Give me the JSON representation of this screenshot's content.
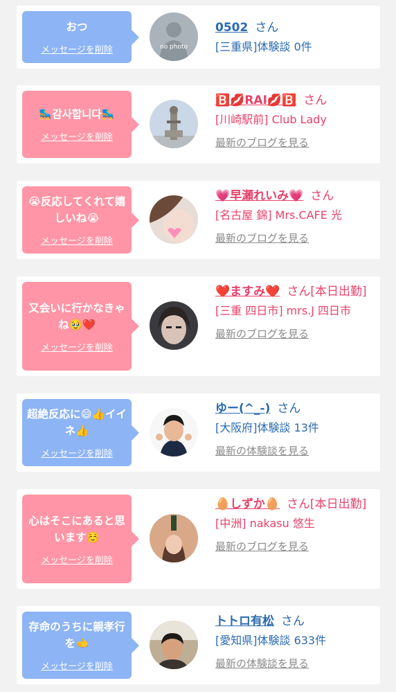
{
  "colors": {
    "blue_bubble": "#8db4f4",
    "pink_bubble": "#ff95a6",
    "blue_text": "#2a6ab0",
    "pink_text": "#e8416a",
    "muted": "#8a8a8a"
  },
  "cards": [
    {
      "message": "おつ",
      "delete_label": "メッセージを削除",
      "bubble_color": "blue",
      "name": "0502",
      "honorific": "さん",
      "subtitle": "[三重県]体験談 0件",
      "link": ""
    },
    {
      "message": "🛼감사합니다🛼",
      "delete_label": "メッセージを削除",
      "bubble_color": "pink",
      "name": "🅱️💋RAI💋🅱️",
      "honorific": "さん",
      "subtitle": "[川崎駅前] Club Lady",
      "link": "最新のブログを見る"
    },
    {
      "message": "😭反応してくれて嬉しいね😭",
      "delete_label": "メッセージを削除",
      "bubble_color": "pink",
      "name": "💗早瀬れいみ💗",
      "honorific": "さん",
      "subtitle": "[名古屋 錦] Mrs.CAFE 光",
      "link": "最新のブログを見る"
    },
    {
      "message": "又会いに行かなきゃね🥹❤️",
      "delete_label": "メッセージを削除",
      "bubble_color": "pink",
      "name": "❤️ますみ❤️",
      "honorific": "さん[本日出勤]",
      "subtitle": "[三重 四日市] mrs.J 四日市",
      "link": "最新のブログを見る"
    },
    {
      "message": "超絶反応に😄👍イイネ👍",
      "delete_label": "メッセージを削除",
      "bubble_color": "blue",
      "name": "ゆー(^_-)",
      "honorific": "さん",
      "subtitle": "[大阪府]体験談 13件",
      "link": "最新の体験談を見る"
    },
    {
      "message": "心はそこにあると思います☺️",
      "delete_label": "メッセージを削除",
      "bubble_color": "pink",
      "name": "🥚しずか🥚",
      "honorific": "さん[本日出勤]",
      "subtitle": "[中洲] nakasu 悠生",
      "link": "最新のブログを見る"
    },
    {
      "message": "存命のうちに親孝行を🫲",
      "delete_label": "メッセージを削除",
      "bubble_color": "blue",
      "name": "トトロ有松",
      "honorific": "さん",
      "subtitle": "[愛知県]体験談 633件",
      "link": "最新の体験談を見る"
    }
  ],
  "avatar_placeholder": {
    "text_1": "no photo"
  }
}
